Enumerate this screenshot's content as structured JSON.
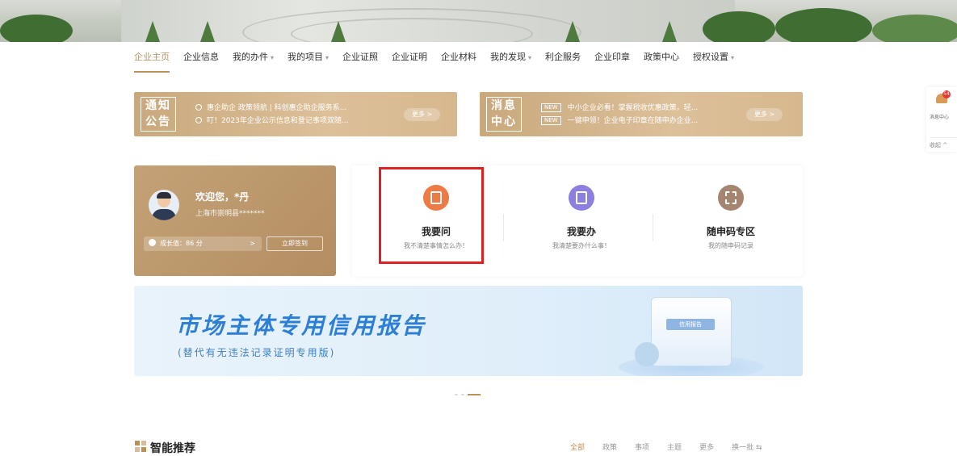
{
  "nav": {
    "items": [
      {
        "label": "企业主页",
        "dropdown": false,
        "active": true
      },
      {
        "label": "企业信息",
        "dropdown": false
      },
      {
        "label": "我的办件",
        "dropdown": true
      },
      {
        "label": "我的项目",
        "dropdown": true
      },
      {
        "label": "企业证照",
        "dropdown": false
      },
      {
        "label": "企业证明",
        "dropdown": false
      },
      {
        "label": "企业材料",
        "dropdown": false
      },
      {
        "label": "我的发现",
        "dropdown": true
      },
      {
        "label": "利企服务",
        "dropdown": false
      },
      {
        "label": "企业印章",
        "dropdown": false
      },
      {
        "label": "政策中心",
        "dropdown": false
      },
      {
        "label": "授权设置",
        "dropdown": true
      }
    ]
  },
  "notice": {
    "tag_top": "通知",
    "tag_bottom": "公告",
    "line1": "惠企助企 政策领航 | 科创惠企助企服务系...",
    "line2": "叮！2023年企业公示信息和登记事项双随...",
    "more": "更多 >"
  },
  "message": {
    "tag_top": "消息",
    "tag_bottom": "中心",
    "new_tag": "NEW",
    "line1": "中小企业必看！掌握税收优惠政策，轻...",
    "line2": "一键申领！企业电子印章在随申办企业...",
    "more": "更多 >"
  },
  "welcome": {
    "greeting": "欢迎您，*丹",
    "org": "上海市崇明县*******",
    "score": "成长值：86 分",
    "score_arrow": ">",
    "sign_in": "立即签到"
  },
  "services": [
    {
      "title": "我要问",
      "subtitle": "我不清楚事情怎么办！",
      "color": "#ee7a45"
    },
    {
      "title": "我要办",
      "subtitle": "我清楚要办什么事！",
      "color": "#8b7fe0"
    },
    {
      "title": "随申码专区",
      "subtitle": "我的随申码记录",
      "color": "#a58470"
    }
  ],
  "report": {
    "title": "市场主体专用信用报告",
    "subtitle": "(替代有无违法记录证明专用版)",
    "doc_label": "信用报告"
  },
  "recommend": {
    "title": "智能推荐",
    "tabs": [
      "全部",
      "政策",
      "事项",
      "主题",
      "更多",
      "换一批 ⇆"
    ]
  },
  "side": {
    "badge": "54",
    "label": "消息中心",
    "collapse": "收起 ^"
  },
  "colors": {
    "accent": "#b9925b",
    "highlight": "#e02020",
    "report_blue": "#2d7fd6"
  }
}
